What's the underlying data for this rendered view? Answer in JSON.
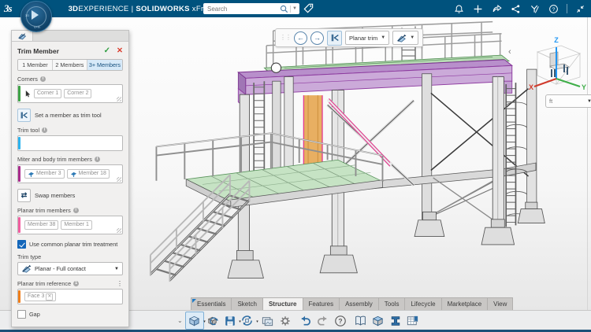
{
  "topbar": {
    "brand": {
      "bold": "3D",
      "light": "EXPERIENCE",
      "sep": "|",
      "product": "SOLIDWORKS",
      "app": "xFrame"
    },
    "search": {
      "placeholder": "Search"
    },
    "icon_names": [
      "tag-icon",
      "notifications-bell-icon",
      "add-plus-icon",
      "share-arrow-icon",
      "share-network-icon",
      "collab-icon",
      "help-icon",
      "collapse-icon"
    ]
  },
  "panel": {
    "title": "Trim Member",
    "confirm_label": "✓",
    "cancel_label": "✕",
    "tabs": [
      "1 Member",
      "2 Members",
      "3+ Members"
    ],
    "active_tab": "3+ Members",
    "corners": {
      "label": "Corners",
      "chips": [
        "Corner 1",
        "Corner 2"
      ],
      "accent": "#3fa447"
    },
    "set_member": {
      "label": "Set a member as trim tool"
    },
    "trim_tool": {
      "label": "Trim tool",
      "accent": "#2bb3ef"
    },
    "miter": {
      "label": "Miter and body trim members",
      "chips": [
        "Member 3",
        "Member 18"
      ],
      "accent": "#a92c8c"
    },
    "swap": {
      "label": "Swap members",
      "glyph": "⇄"
    },
    "planar_members": {
      "label": "Planar trim members",
      "chips": [
        "Member 38",
        "Member 1"
      ],
      "accent": "#f25fa0"
    },
    "common": {
      "label": "Use common planar trim treatment",
      "checked": true
    },
    "trim_type": {
      "label": "Trim type",
      "value": "Planar - Full contact"
    },
    "planar_ref": {
      "label": "Planar trim reference",
      "chips": [
        "Face 3"
      ],
      "accent": "#f07e1a"
    },
    "gap": {
      "label": "Gap",
      "checked": false
    }
  },
  "viewport": {
    "toolbar": {
      "dropdown_label": "Planar trim"
    },
    "units": {
      "value": "ft"
    },
    "triad": {
      "x": "X",
      "y": "Y",
      "z": "Z"
    },
    "triad_colors": {
      "x": "#d03a2b",
      "y": "#3fae49",
      "z": "#2196f3"
    },
    "highlight_colors": {
      "selected_member": "#c9a3d8",
      "preview_member": "#e9b160",
      "reference_pink": "#e23a8e",
      "floor_green": "#bfe0bd"
    }
  },
  "bottom": {
    "tabs": [
      "Essentials",
      "Sketch",
      "Structure",
      "Features",
      "Assembly",
      "Tools",
      "Lifecycle",
      "Marketplace",
      "View"
    ],
    "active_tab": "Structure",
    "toolbar_icon_names": [
      "new-model-icon",
      "rebuild-icon",
      "save-icon",
      "update-icon",
      "export-image-icon",
      "settings-gear-icon",
      "undo-icon",
      "redo-icon",
      "help-circle-icon",
      "catalog-book-icon",
      "solid-cube-icon",
      "structure-member-icon",
      "bom-table-icon"
    ]
  }
}
